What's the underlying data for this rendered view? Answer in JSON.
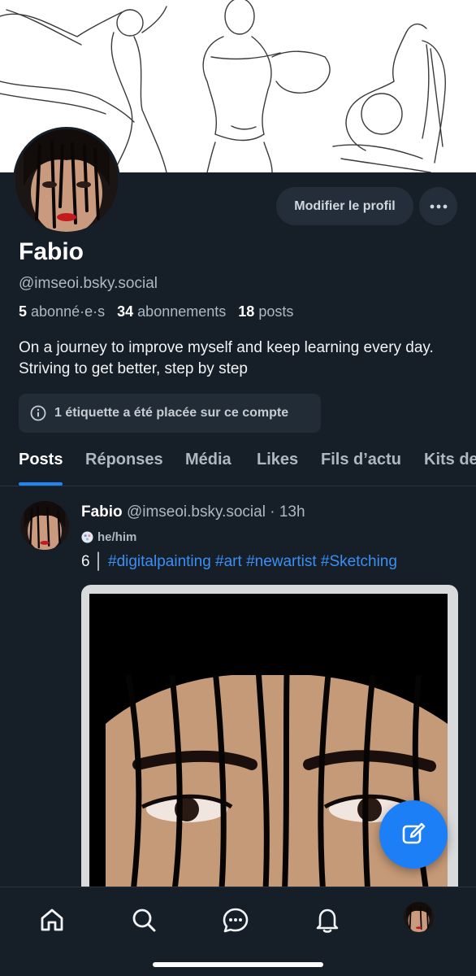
{
  "profile": {
    "name": "Fabio",
    "handle": "@imseoi.bsky.social",
    "followers_count": "5",
    "followers_label": "abonné·e·s",
    "following_count": "34",
    "following_label": "abonnements",
    "posts_count": "18",
    "posts_label": "posts",
    "bio": "On a journey to improve myself and keep learning every day. Striving to get better, step by step",
    "edit_button": "Modifier le profil",
    "label_notice": "1 étiquette a été placée sur ce compte"
  },
  "tabs": [
    {
      "label": "Posts",
      "active": true
    },
    {
      "label": "Réponses",
      "active": false
    },
    {
      "label": "Média",
      "active": false
    },
    {
      "label": "Likes",
      "active": false
    },
    {
      "label": "Fils d’actu",
      "active": false
    },
    {
      "label": "Kits de",
      "active": false
    }
  ],
  "post": {
    "author_name": "Fabio",
    "author_handle": "@imseoi.bsky.social",
    "separator": " · ",
    "time": "13h",
    "pronouns": "he/him",
    "text_prefix": "6 │ ",
    "hashtags": "#digitalpainting #art #newartist #Sketching"
  },
  "icons": {
    "more": "ellipsis-icon",
    "info": "info-circle-icon",
    "compose": "compose-icon",
    "nav": [
      "home-icon",
      "search-icon",
      "chat-icon",
      "bell-icon",
      "profile-avatar"
    ]
  },
  "colors": {
    "background": "#161e27",
    "accent": "#1d7ff5",
    "hashtag": "#3b8ff5"
  }
}
